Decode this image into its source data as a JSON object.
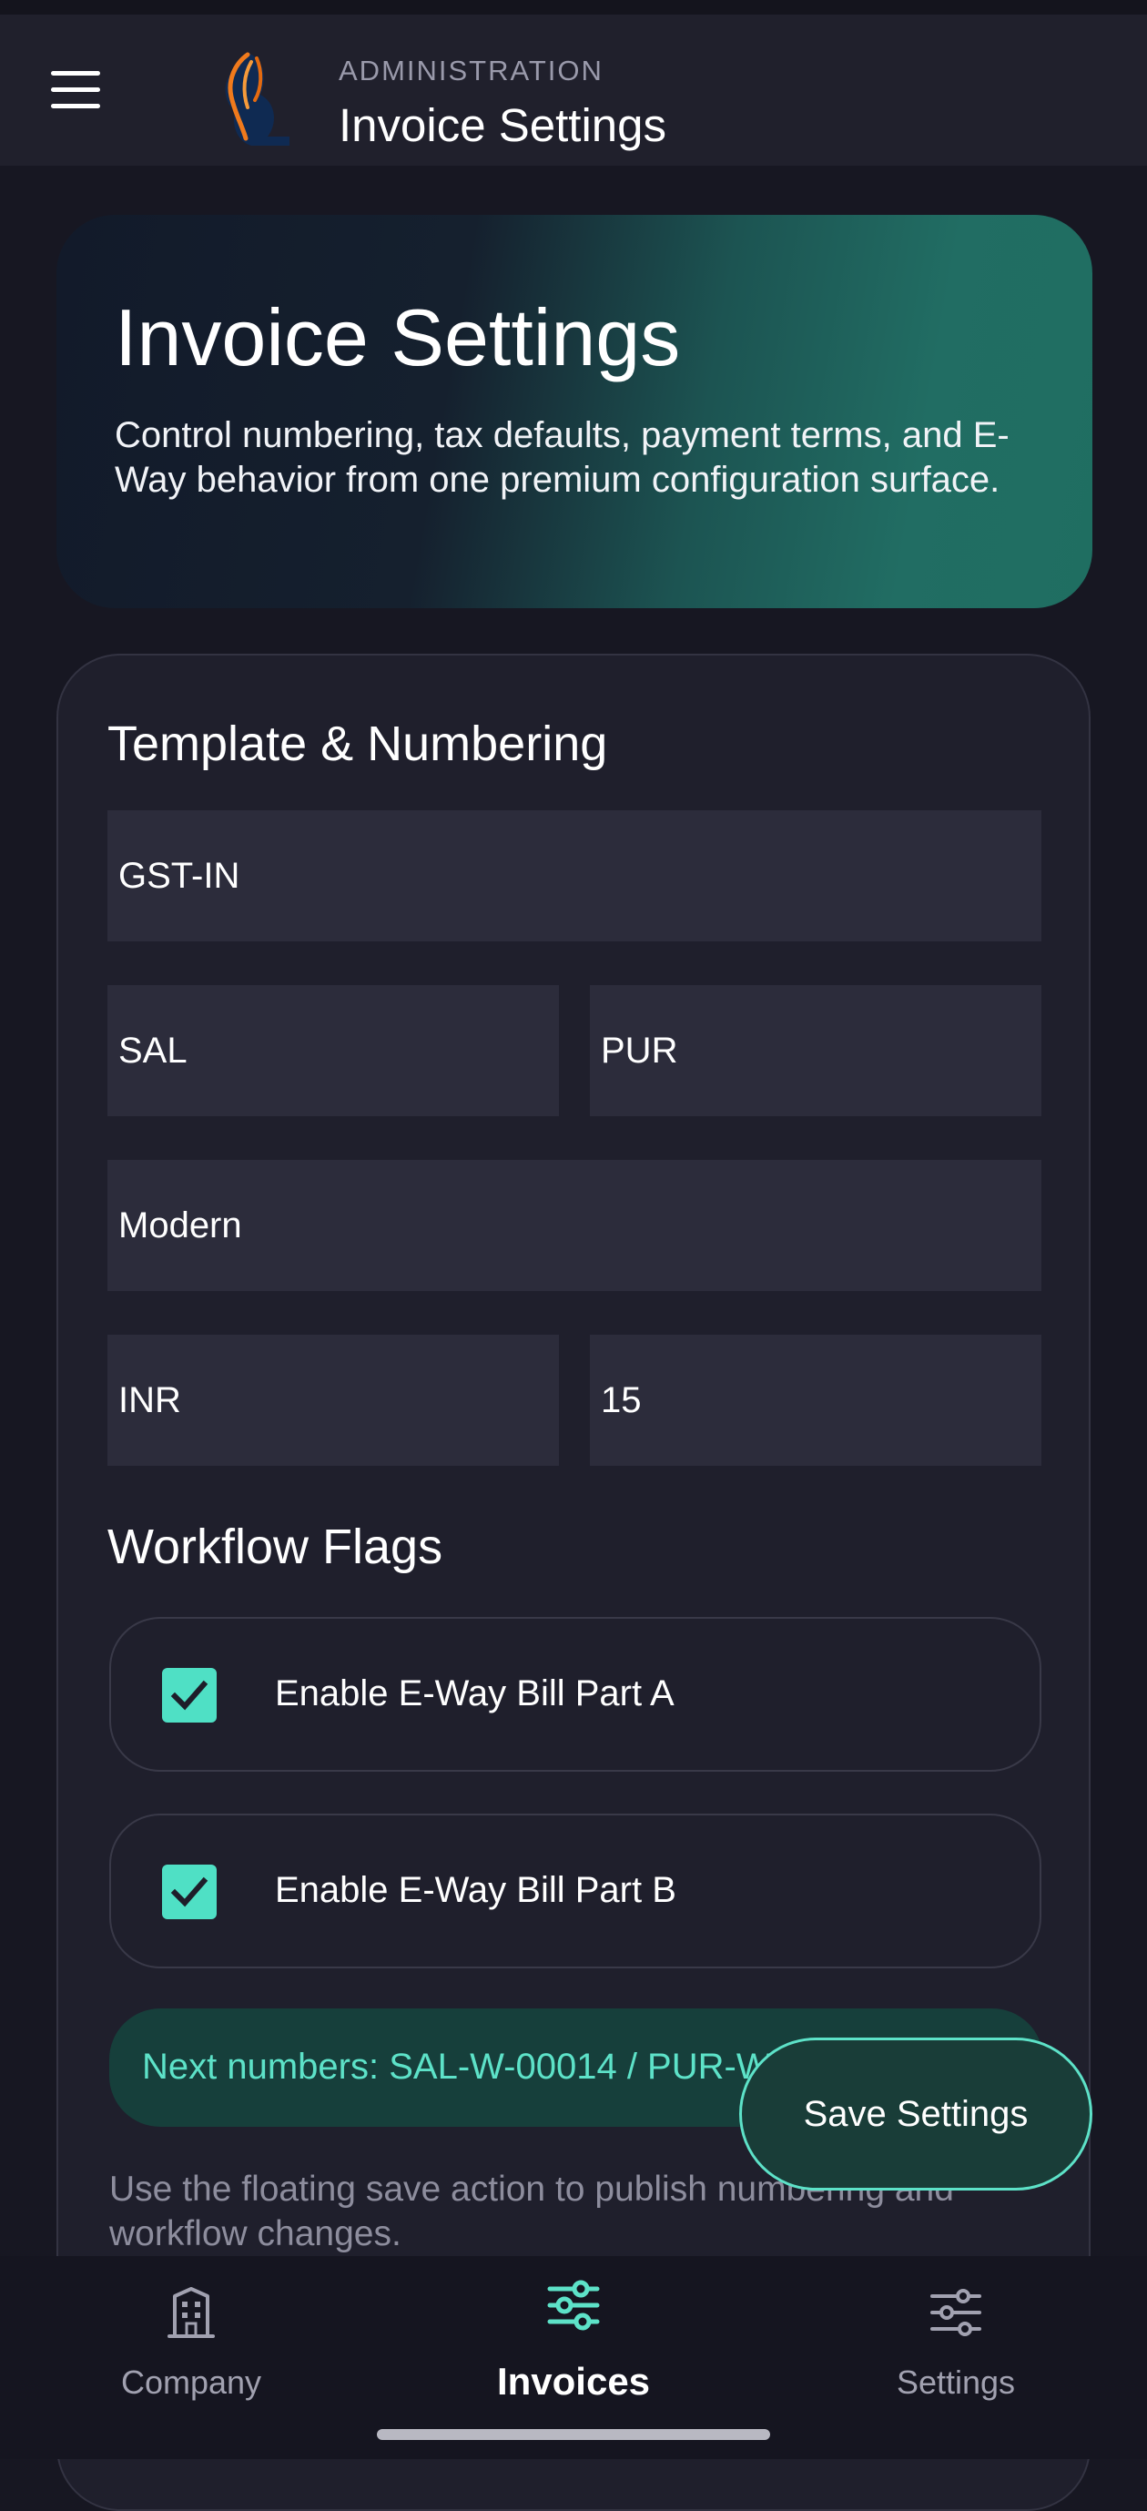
{
  "app_bar": {
    "overline": "ADMINISTRATION",
    "title": "Invoice Settings",
    "menu_icon": "menu-icon",
    "logo_icon": "conch-shell-logo"
  },
  "hero": {
    "title": "Invoice Settings",
    "description": "Control numbering, tax defaults, payment terms, and E-Way behavior from one premium configuration surface."
  },
  "template_numbering": {
    "title": "Template & Numbering",
    "fields": {
      "template_code": "GST-IN",
      "sales_prefix": "SAL",
      "purchase_prefix": "PUR",
      "template_style": "Modern",
      "currency": "INR",
      "payment_days": "15"
    }
  },
  "workflow_flags": {
    "title": "Workflow Flags",
    "items": [
      {
        "label": "Enable E-Way Bill Part A",
        "checked": true
      },
      {
        "label": "Enable E-Way Bill Part B",
        "checked": true
      }
    ]
  },
  "next_numbers": "Next numbers: SAL-W-00014 / PUR-W-00009",
  "hint": "Use the floating save action to publish numbering and workflow changes.",
  "fab": {
    "label": "Save Settings"
  },
  "bottom_nav": {
    "items": [
      {
        "label": "Company",
        "icon": "building-icon",
        "active": false
      },
      {
        "label": "Invoices",
        "icon": "sliders-icon",
        "active": true
      },
      {
        "label": "Settings",
        "icon": "sliders-icon",
        "active": false
      }
    ]
  },
  "colors": {
    "accent": "#5de2c8",
    "checkbox": "#4fe0c5",
    "surface": "#1f1f2c",
    "field": "#2c2c3b",
    "background": "#171722"
  }
}
